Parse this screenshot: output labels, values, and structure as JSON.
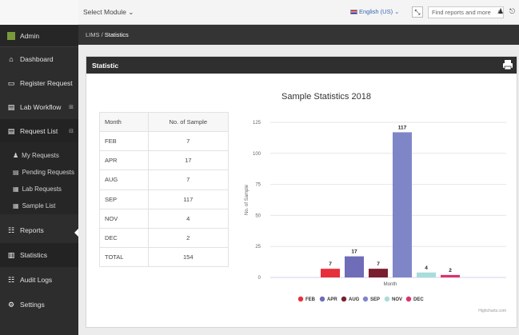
{
  "topbar": {
    "module_select": "Select Module ⌄",
    "language": "English (US) ⌄",
    "search_placeholder": "Find reports and more"
  },
  "sidebar": {
    "brand": "Admin",
    "items": [
      {
        "label": "Dashboard",
        "icon": "home-icon"
      },
      {
        "label": "Register Request",
        "icon": "laptop-icon"
      },
      {
        "label": "Lab Workflow",
        "icon": "book-icon",
        "indicator": "⊞"
      },
      {
        "label": "Request List",
        "icon": "book-icon",
        "indicator": "⊟"
      },
      {
        "label": "Reports",
        "icon": "grid-icon"
      },
      {
        "label": "Statistics",
        "icon": "bar-chart-icon"
      },
      {
        "label": "Audit Logs",
        "icon": "grid-icon"
      },
      {
        "label": "Settings",
        "icon": "gears-icon"
      }
    ],
    "subitems": [
      {
        "label": "My Requests"
      },
      {
        "label": "Pending Requests"
      },
      {
        "label": "Lab Requests"
      },
      {
        "label": "Sample List"
      }
    ]
  },
  "breadcrumb": {
    "root": "LIMS",
    "separator": "/",
    "current": "Statistics"
  },
  "panel": {
    "title": "Statistic"
  },
  "table": {
    "headers": [
      "Month",
      "No. of Sample"
    ],
    "rows": [
      [
        "FEB",
        "7"
      ],
      [
        "APR",
        "17"
      ],
      [
        "AUG",
        "7"
      ],
      [
        "SEP",
        "117"
      ],
      [
        "NOV",
        "4"
      ],
      [
        "DEC",
        "2"
      ],
      [
        "TOTAL",
        "154"
      ]
    ]
  },
  "chart_data": {
    "type": "bar",
    "title": "Sample Statistics 2018",
    "xlabel": "Month",
    "ylabel": "No. of Sample",
    "ylim": [
      0,
      125
    ],
    "yticks": [
      0,
      25,
      50,
      75,
      100,
      125
    ],
    "grid": true,
    "legend": "bottom",
    "series": [
      {
        "name": "FEB",
        "value": 7,
        "color": "#e8303a"
      },
      {
        "name": "APR",
        "value": 17,
        "color": "#6f6cb8"
      },
      {
        "name": "AUG",
        "value": 7,
        "color": "#7a1f2f"
      },
      {
        "name": "SEP",
        "value": 117,
        "color": "#7f86c8"
      },
      {
        "name": "NOV",
        "value": 4,
        "color": "#a9dcdc"
      },
      {
        "name": "DEC",
        "value": 2,
        "color": "#e0306a"
      }
    ],
    "credits": "Highcharts.com"
  }
}
